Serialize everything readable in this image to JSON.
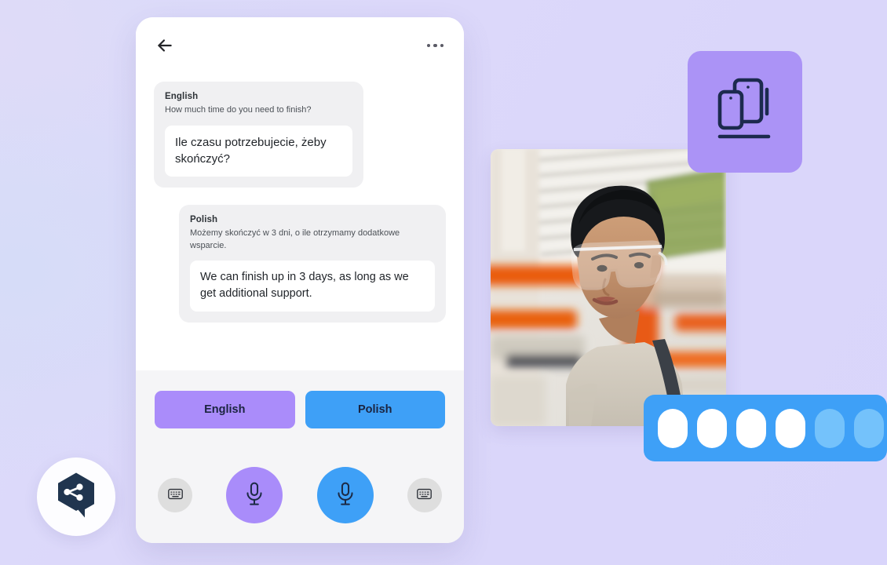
{
  "app": {
    "background_start": "#dbdcf9",
    "background_end": "#d9d5fb"
  },
  "phone": {
    "header": {
      "back_icon": "back-arrow-icon",
      "menu_icon": "more-options-icon"
    },
    "messages": [
      {
        "language": "English",
        "source_text": "How much time do you need to finish?",
        "translated_text": "Ile czasu potrzebujecie, żeby skończyć?",
        "side": "left"
      },
      {
        "language": "Polish",
        "source_text": "Możemy skończyć w 3 dni, o ile otrzymamy dodatkowe wsparcie.",
        "translated_text": "We can finish up in 3 days, as long as we get additional support.",
        "side": "right"
      }
    ],
    "language_buttons": [
      {
        "label": "English",
        "color": "#aa8cfa"
      },
      {
        "label": "Polish",
        "color": "#3ea0f7"
      }
    ],
    "controls": [
      {
        "name": "keyboard-left",
        "icon": "keyboard-icon",
        "color": "#dedede"
      },
      {
        "name": "mic-english",
        "icon": "microphone-icon",
        "color": "#a98cfa"
      },
      {
        "name": "mic-polish",
        "icon": "microphone-icon",
        "color": "#3ea0f7"
      },
      {
        "name": "keyboard-right",
        "icon": "keyboard-icon",
        "color": "#dedede"
      }
    ]
  },
  "photo": {
    "alt": "Young man wearing clear safety glasses in a warehouse aisle with orange racking"
  },
  "devices_card": {
    "icon": "multiple-devices-icon",
    "color": "#ab93f6"
  },
  "pills_card": {
    "color": "#3ea0f7",
    "filled_count": 4,
    "total_count": 6,
    "pills": [
      "on",
      "on",
      "on",
      "on",
      "off",
      "off"
    ]
  },
  "logo": {
    "icon": "share-bubble-logo-icon",
    "badge_color": "#fdfdff",
    "mark_color": "#20354f"
  }
}
